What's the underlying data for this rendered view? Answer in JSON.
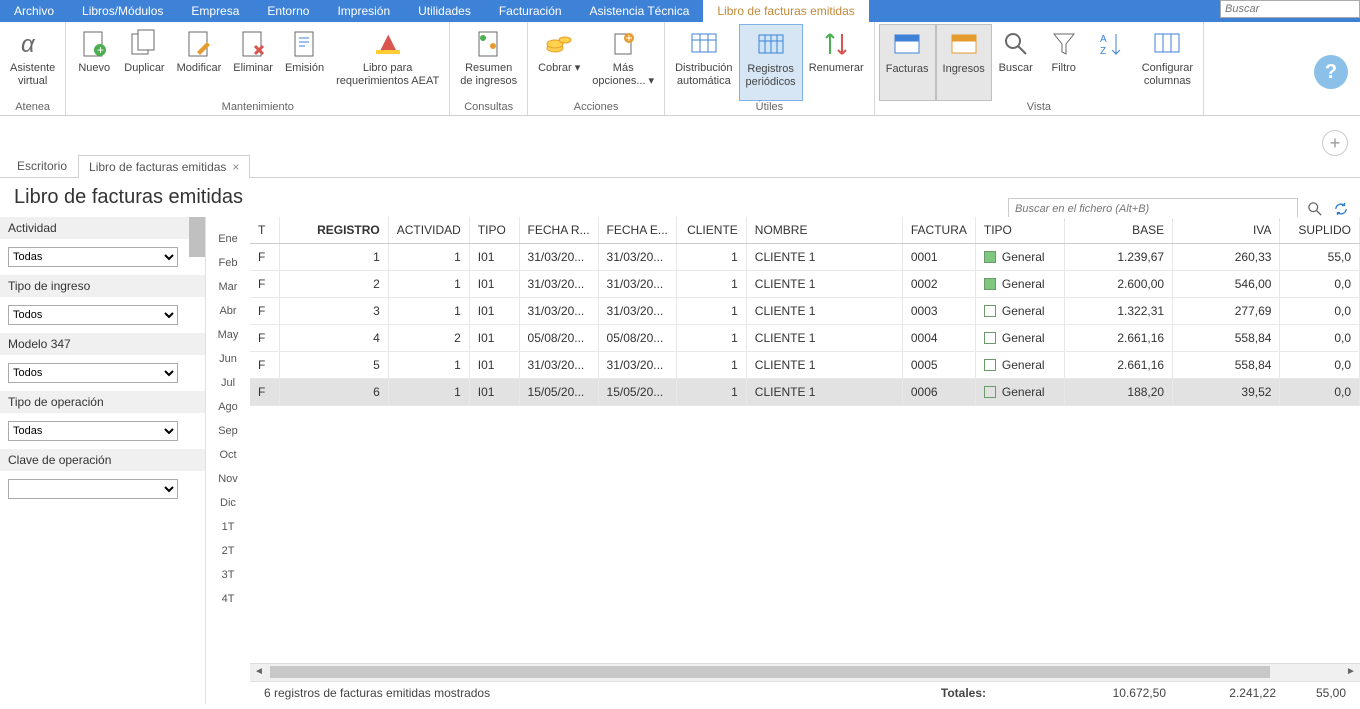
{
  "menubar": {
    "items": [
      "Archivo",
      "Libros/Módulos",
      "Empresa",
      "Entorno",
      "Impresión",
      "Utilidades",
      "Facturación",
      "Asistencia Técnica",
      "Libro de facturas emitidas"
    ],
    "active_index": 8,
    "search_placeholder": "Buscar"
  },
  "ribbon": {
    "groups": [
      {
        "label": "Atenea",
        "buttons": [
          {
            "name": "asistente-virtual",
            "label": "Asistente\nvirtual"
          }
        ]
      },
      {
        "label": "Mantenimiento",
        "buttons": [
          {
            "name": "nuevo",
            "label": "Nuevo"
          },
          {
            "name": "duplicar",
            "label": "Duplicar"
          },
          {
            "name": "modificar",
            "label": "Modificar"
          },
          {
            "name": "eliminar",
            "label": "Eliminar"
          },
          {
            "name": "emision",
            "label": "Emisión"
          },
          {
            "name": "libro-para-requerimientos-aeat",
            "label": "Libro para\nrequerimientos AEAT"
          }
        ]
      },
      {
        "label": "Consultas",
        "buttons": [
          {
            "name": "resumen-de-ingresos",
            "label": "Resumen\nde ingresos"
          }
        ]
      },
      {
        "label": "Acciones",
        "buttons": [
          {
            "name": "cobrar",
            "label": "Cobrar",
            "dd": true
          },
          {
            "name": "mas-opciones",
            "label": "Más\nopciones...",
            "dd": true
          }
        ]
      },
      {
        "label": "Útiles",
        "buttons": [
          {
            "name": "distribucion-automatica",
            "label": "Distribución\nautomática"
          },
          {
            "name": "registros-periodicos",
            "label": "Registros\nperiódicos",
            "selected": true
          },
          {
            "name": "renumerar",
            "label": "Renumerar"
          }
        ]
      },
      {
        "label": "Vista",
        "buttons": [
          {
            "name": "facturas",
            "label": "Facturas",
            "toggled": true
          },
          {
            "name": "ingresos",
            "label": "Ingresos",
            "toggled": true
          },
          {
            "name": "buscar",
            "label": "Buscar"
          },
          {
            "name": "filtro",
            "label": "Filtro"
          },
          {
            "name": "ordenar",
            "label": ""
          },
          {
            "name": "configurar-columnas",
            "label": "Configurar\ncolumnas"
          }
        ]
      }
    ]
  },
  "tabs": [
    {
      "label": "Escritorio",
      "closable": false
    },
    {
      "label": "Libro de facturas emitidas",
      "closable": true,
      "active": true
    }
  ],
  "page_title": "Libro de facturas emitidas",
  "search_in_file": {
    "placeholder": "Buscar en el fichero (Alt+B)"
  },
  "sidebar": {
    "filters": [
      {
        "label": "Actividad",
        "value": "Todas"
      },
      {
        "label": "Tipo de ingreso",
        "value": "Todos"
      },
      {
        "label": "Modelo 347",
        "value": "Todos"
      },
      {
        "label": "Tipo de operación",
        "value": "Todas"
      },
      {
        "label": "Clave de operación",
        "value": ""
      }
    ]
  },
  "months": [
    "Ene",
    "Feb",
    "Mar",
    "Abr",
    "May",
    "Jun",
    "Jul",
    "Ago",
    "Sep",
    "Oct",
    "Nov",
    "Dic",
    "1T",
    "2T",
    "3T",
    "4T"
  ],
  "grid": {
    "columns": [
      "T",
      "REGISTRO",
      "ACTIVIDAD",
      "TIPO",
      "FECHA R...",
      "FECHA E...",
      "CLIENTE",
      "NOMBRE",
      "FACTURA",
      "TIPO",
      "BASE",
      "IVA",
      "SUPLIDO"
    ],
    "bold_col_index": 1,
    "rows": [
      {
        "t": "F",
        "registro": "1",
        "actividad": "1",
        "tipo_c": "I01",
        "fecha_r": "31/03/20...",
        "fecha_e": "31/03/20...",
        "cliente": "1",
        "nombre": "CLIENTE 1",
        "factura": "0001",
        "tipo": "General",
        "tipo_green": true,
        "base": "1.239,67",
        "iva": "260,33",
        "suplido": "55,0"
      },
      {
        "t": "F",
        "registro": "2",
        "actividad": "1",
        "tipo_c": "I01",
        "fecha_r": "31/03/20...",
        "fecha_e": "31/03/20...",
        "cliente": "1",
        "nombre": "CLIENTE 1",
        "factura": "0002",
        "tipo": "General",
        "tipo_green": true,
        "base": "2.600,00",
        "iva": "546,00",
        "suplido": "0,0"
      },
      {
        "t": "F",
        "registro": "3",
        "actividad": "1",
        "tipo_c": "I01",
        "fecha_r": "31/03/20...",
        "fecha_e": "31/03/20...",
        "cliente": "1",
        "nombre": "CLIENTE 1",
        "factura": "0003",
        "tipo": "General",
        "tipo_green": false,
        "base": "1.322,31",
        "iva": "277,69",
        "suplido": "0,0"
      },
      {
        "t": "F",
        "registro": "4",
        "actividad": "2",
        "tipo_c": "I01",
        "fecha_r": "05/08/20...",
        "fecha_e": "05/08/20...",
        "cliente": "1",
        "nombre": "CLIENTE 1",
        "factura": "0004",
        "tipo": "General",
        "tipo_green": false,
        "base": "2.661,16",
        "iva": "558,84",
        "suplido": "0,0"
      },
      {
        "t": "F",
        "registro": "5",
        "actividad": "1",
        "tipo_c": "I01",
        "fecha_r": "31/03/20...",
        "fecha_e": "31/03/20...",
        "cliente": "1",
        "nombre": "CLIENTE 1",
        "factura": "0005",
        "tipo": "General",
        "tipo_green": false,
        "base": "2.661,16",
        "iva": "558,84",
        "suplido": "0,0"
      },
      {
        "t": "F",
        "registro": "6",
        "actividad": "1",
        "tipo_c": "I01",
        "fecha_r": "15/05/20...",
        "fecha_e": "15/05/20...",
        "cliente": "1",
        "nombre": "CLIENTE 1",
        "factura": "0006",
        "tipo": "General",
        "tipo_green": false,
        "base": "188,20",
        "iva": "39,52",
        "suplido": "0,0",
        "selected": true
      }
    ]
  },
  "footer": {
    "status": "6 registros de facturas emitidas mostrados",
    "totals_label": "Totales:",
    "base": "10.672,50",
    "iva": "2.241,22",
    "suplido": "55,00"
  }
}
